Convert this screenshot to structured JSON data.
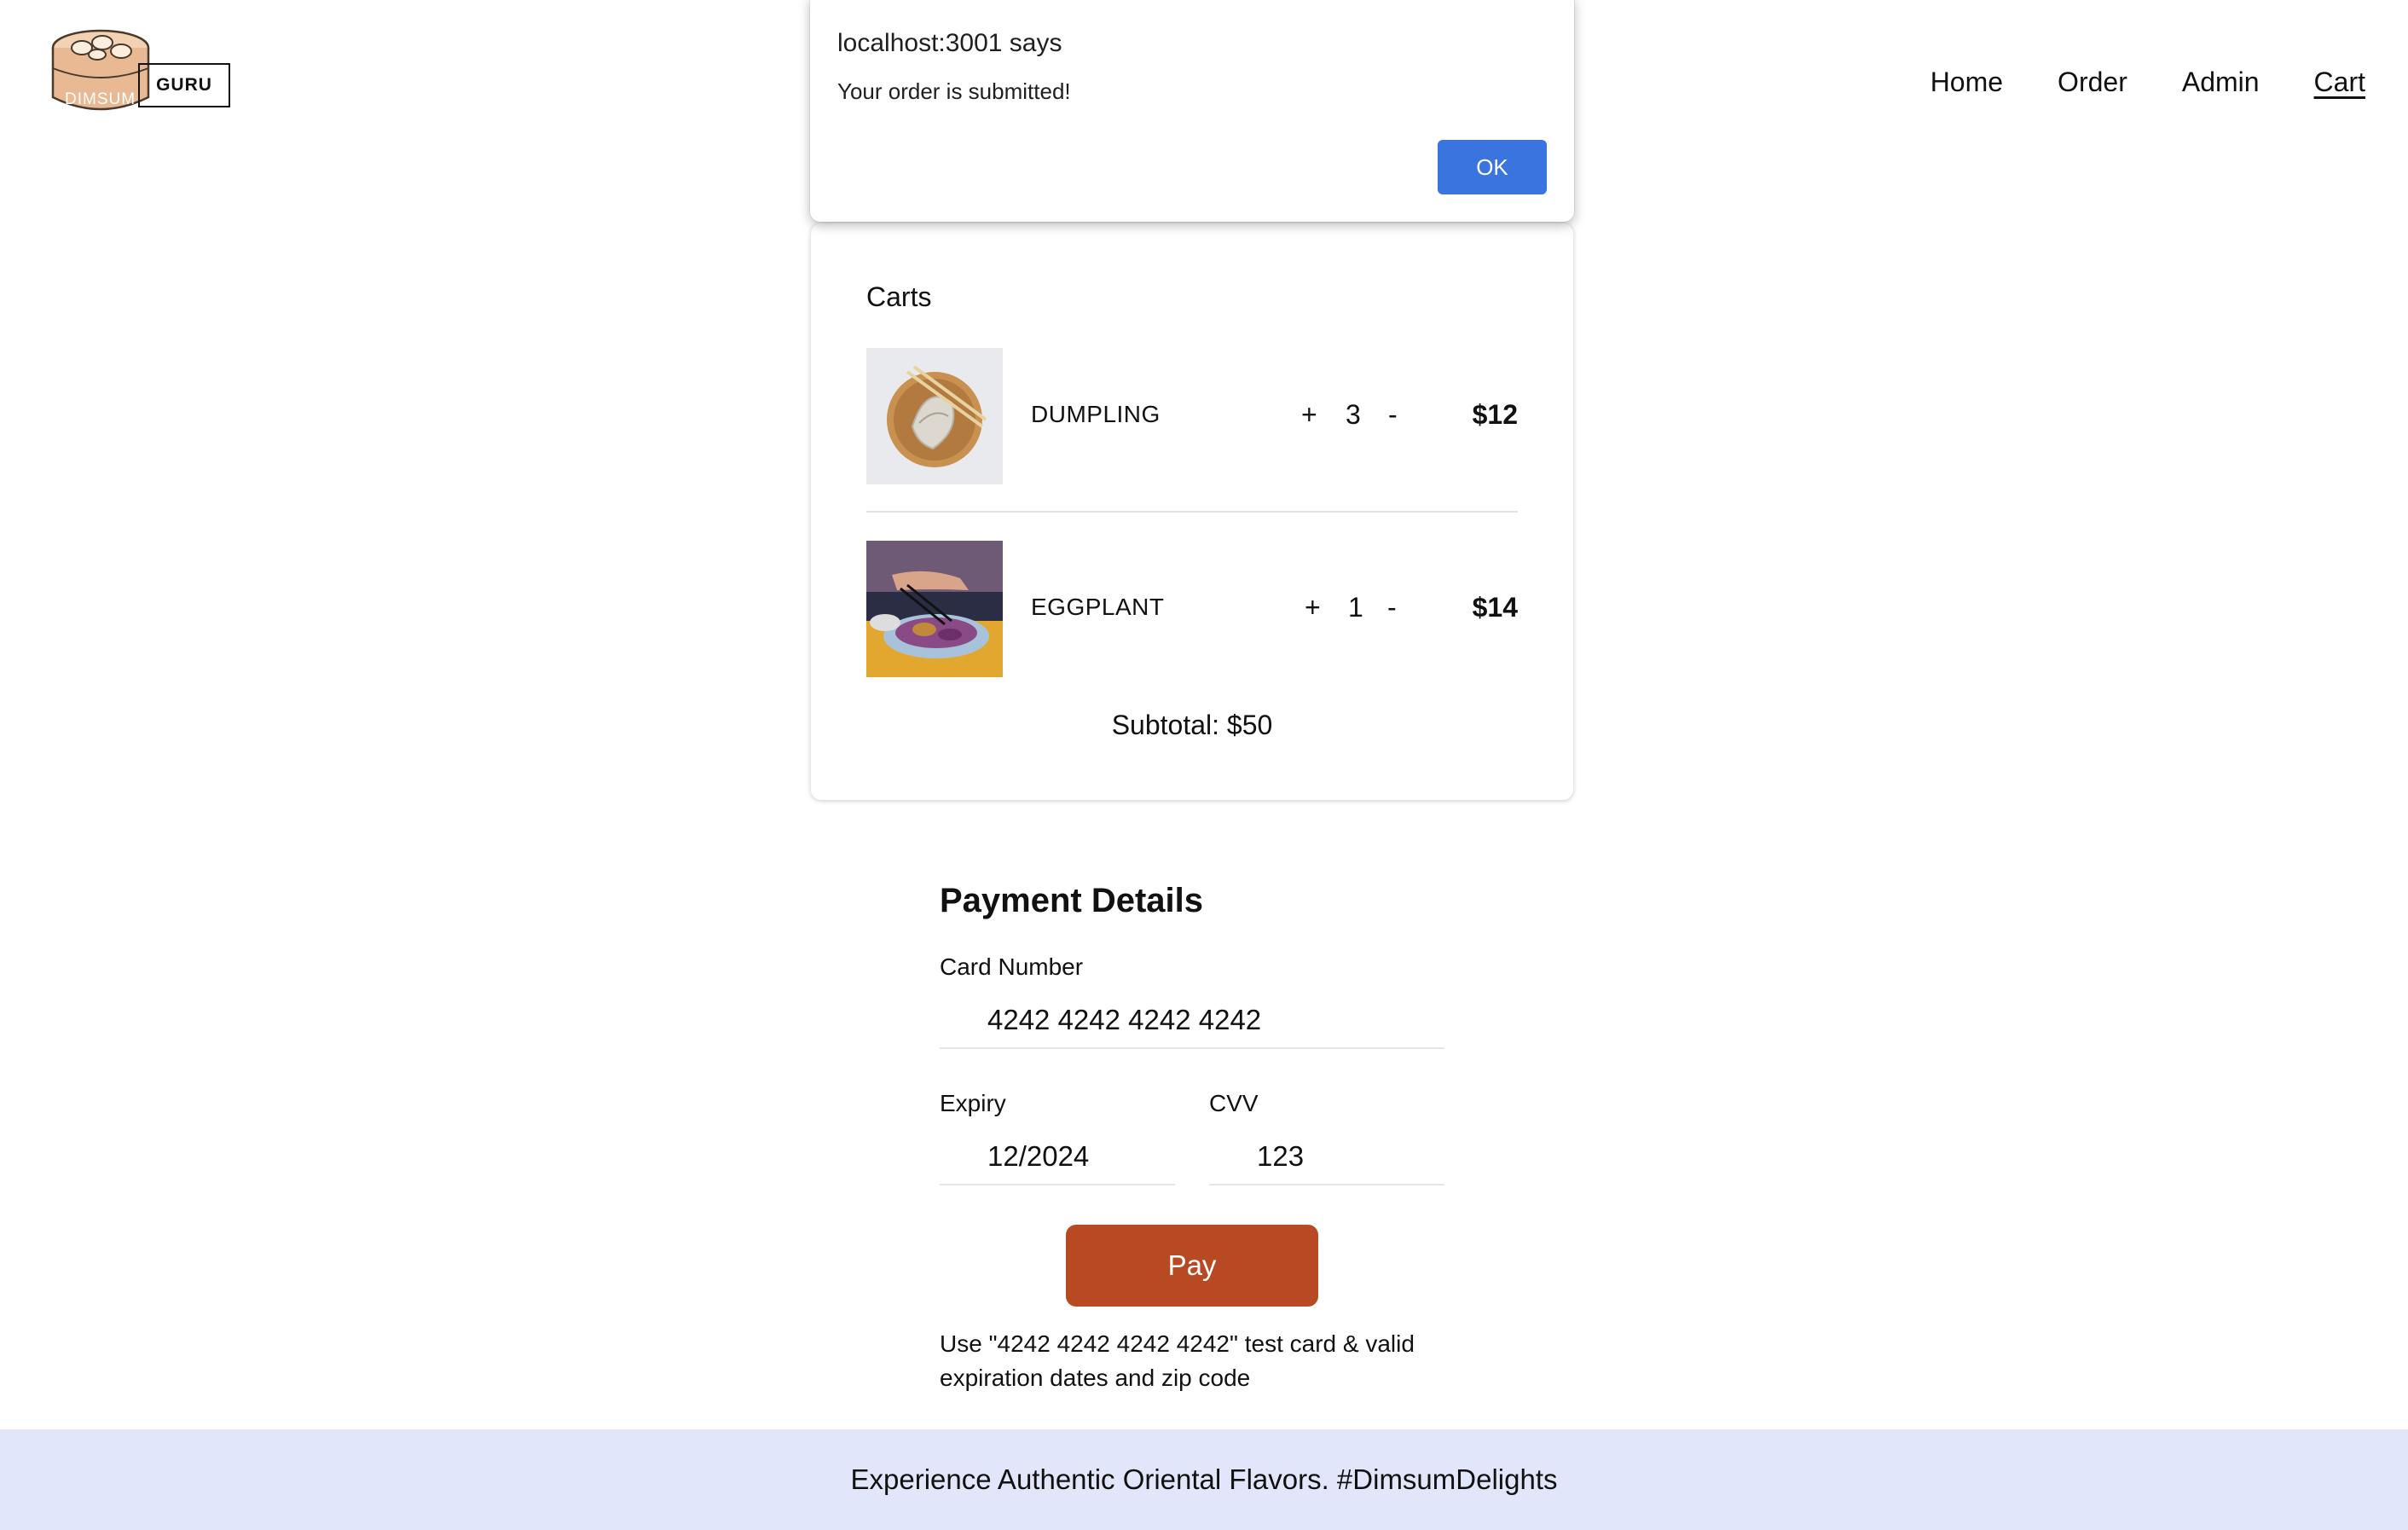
{
  "header": {
    "logo": {
      "badge_text": "GURU",
      "steamer_text": "DIMSUM"
    },
    "nav": [
      "Home",
      "Order",
      "Admin",
      "Cart"
    ],
    "active_nav": "Cart"
  },
  "cart": {
    "title": "Carts",
    "items": [
      {
        "name": "DUMPLING",
        "plus": "+",
        "qty": "3",
        "minus": "-",
        "price": "$12",
        "image": "dumpling-plate-image"
      },
      {
        "name": "EGGPLANT",
        "plus": "+",
        "qty": "1",
        "minus": "-",
        "price": "$14",
        "image": "eggplant-dish-image"
      }
    ],
    "subtotal": "Subtotal: $50"
  },
  "payment": {
    "title": "Payment Details",
    "card_number_label": "Card Number",
    "card_number_value": "4242 4242 4242 4242",
    "expiry_label": "Expiry",
    "expiry_value": "12/2024",
    "cvv_label": "CVV",
    "cvv_value": "123",
    "pay_label": "Pay",
    "pay_color": "#b84a23",
    "hint": "Use \"4242 4242 4242 4242\" test card & valid expiration dates and zip code"
  },
  "footer": {
    "text": "Experience Authentic Oriental Flavors. #DimsumDelights",
    "background": "#e1e6fb"
  },
  "dialog": {
    "title": "localhost:3001 says",
    "message": "Your order is submitted!",
    "ok_label": "OK",
    "ok_color": "#3a74de"
  }
}
